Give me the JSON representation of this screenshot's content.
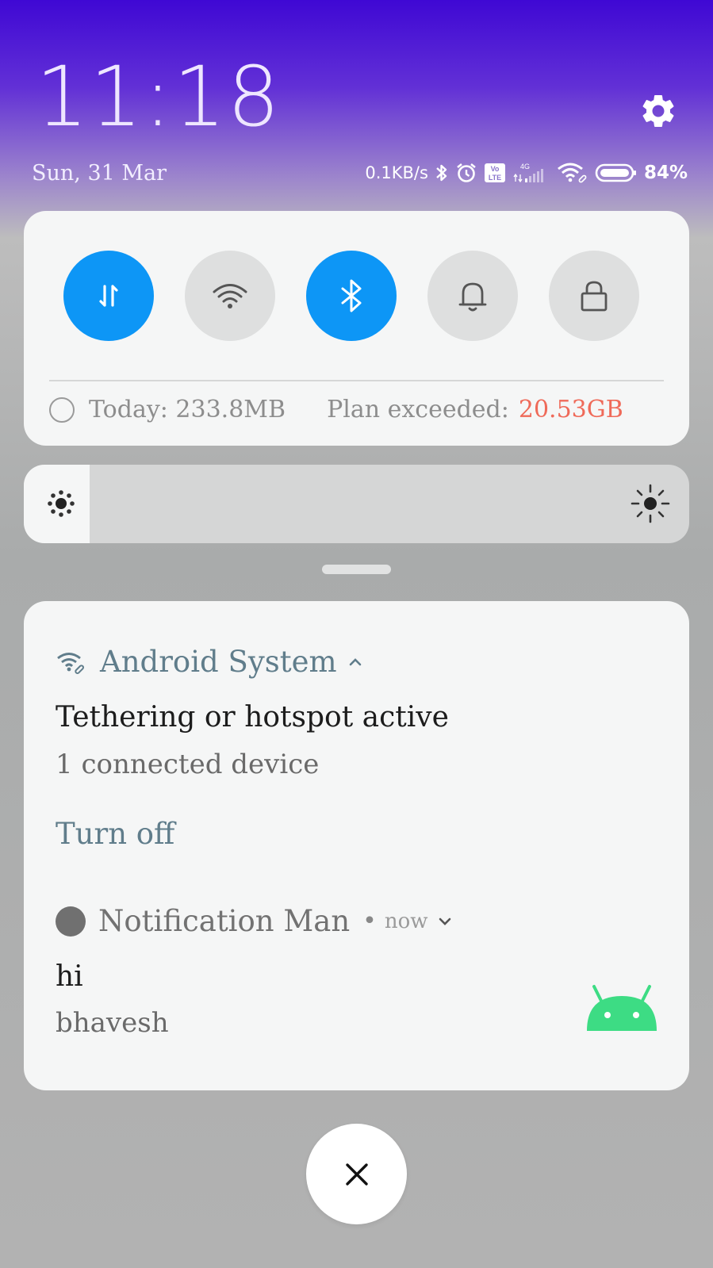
{
  "status_bar": {
    "time": "11:18",
    "date": "Sun, 31 Mar",
    "network_speed": "0.1KB/s",
    "network_type": "4G",
    "volte_top": "Vo",
    "volte_bottom": "LTE",
    "battery_percent": "84%",
    "icons": [
      "bluetooth-icon",
      "alarm-icon",
      "volte-icon",
      "signal-icon",
      "wifi-icon",
      "battery-icon"
    ]
  },
  "quick_settings": {
    "toggles": [
      {
        "name": "mobile-data",
        "icon": "data-arrows-icon",
        "state": "on"
      },
      {
        "name": "wifi",
        "icon": "wifi-icon",
        "state": "off"
      },
      {
        "name": "bluetooth",
        "icon": "bluetooth-icon",
        "state": "on"
      },
      {
        "name": "sound",
        "icon": "bell-icon",
        "state": "off"
      },
      {
        "name": "lock",
        "icon": "lock-icon",
        "state": "off"
      }
    ],
    "data_today": "Today: 233.8MB",
    "plan_label": "Plan exceeded:",
    "plan_value": "20.53GB"
  },
  "brightness": {
    "level": 0.0
  },
  "notifications": [
    {
      "app": "Android System",
      "app_icon": "wifi-tether-icon",
      "title": "Tethering or hotspot active",
      "text": "1 connected device",
      "action": "Turn off",
      "expanded": true
    },
    {
      "app": "Notification Man",
      "separator": "•",
      "time": "now",
      "title": "hi",
      "text": "bhavesh",
      "large_icon": "android-icon"
    }
  ],
  "colors": {
    "accent": "#0d96f6",
    "plan_exceeded": "#ef6a59",
    "app_header": "#607d8b",
    "android_green": "#3ddc84"
  }
}
